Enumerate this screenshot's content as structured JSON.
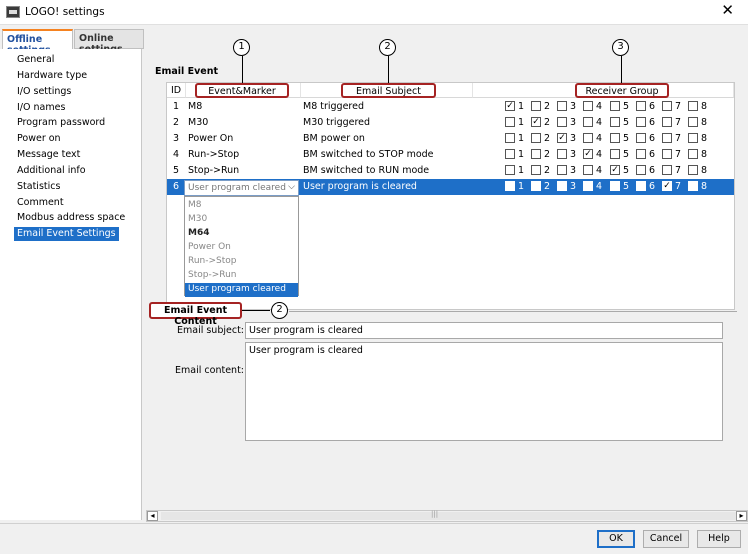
{
  "window": {
    "title": "LOGO! settings",
    "close": "✕"
  },
  "tabs": [
    {
      "label": "Offline settings",
      "active": true
    },
    {
      "label": "Online settings",
      "active": false
    }
  ],
  "sidebar": {
    "items": [
      {
        "label": "General"
      },
      {
        "label": "Hardware type"
      },
      {
        "label": "I/O settings"
      },
      {
        "label": "I/O names"
      },
      {
        "label": "Program password"
      },
      {
        "label": "Power on"
      },
      {
        "label": "Message text"
      },
      {
        "label": "Additional info"
      },
      {
        "label": "Statistics"
      },
      {
        "label": "Comment"
      },
      {
        "label": "Modbus address space"
      },
      {
        "label": "Email Event Settings",
        "selected": true
      }
    ]
  },
  "email_event": {
    "section_title": "Email Event",
    "columns": {
      "id": "ID",
      "event": "Event&Marker",
      "subject": "Email Subject",
      "group": "Receiver Group"
    },
    "group_numbers": [
      "1",
      "2",
      "3",
      "4",
      "5",
      "6",
      "7",
      "8"
    ],
    "rows": [
      {
        "id": "1",
        "event": "M8",
        "subject": "M8 triggered",
        "checked": [
          1
        ]
      },
      {
        "id": "2",
        "event": "M30",
        "subject": "M30 triggered",
        "checked": [
          2
        ]
      },
      {
        "id": "3",
        "event": "Power On",
        "subject": "BM power on",
        "checked": [
          3
        ]
      },
      {
        "id": "4",
        "event": "Run->Stop",
        "subject": "BM switched to STOP mode",
        "checked": [
          4
        ]
      },
      {
        "id": "5",
        "event": "Stop->Run",
        "subject": "BM switched to RUN mode",
        "checked": [
          5
        ]
      },
      {
        "id": "6",
        "event": "User program cleared",
        "subject": "User program is cleared",
        "checked": [
          7
        ],
        "selected": true
      }
    ],
    "dropdown": {
      "value": "User program cleared",
      "options": [
        {
          "label": "M8",
          "style": "dim"
        },
        {
          "label": "M30",
          "style": "dim"
        },
        {
          "label": "M64",
          "style": "bold"
        },
        {
          "label": "Power On",
          "style": "dim"
        },
        {
          "label": "Run->Stop",
          "style": "dim"
        },
        {
          "label": "Stop->Run",
          "style": "dim"
        },
        {
          "label": "User program cleared",
          "style": "selected"
        }
      ]
    }
  },
  "content_section": {
    "title": "Email Event Content",
    "subject_label": "Email subject:",
    "subject_value": "User program is cleared",
    "content_label": "Email content:",
    "content_value": "User program is cleared"
  },
  "callouts": {
    "c1": "1",
    "c2": "2",
    "c3": "3",
    "c2b": "2"
  },
  "scrollbar": {
    "left": "◂",
    "right": "▸"
  },
  "buttons": {
    "ok": "OK",
    "cancel": "Cancel",
    "help": "Help"
  }
}
